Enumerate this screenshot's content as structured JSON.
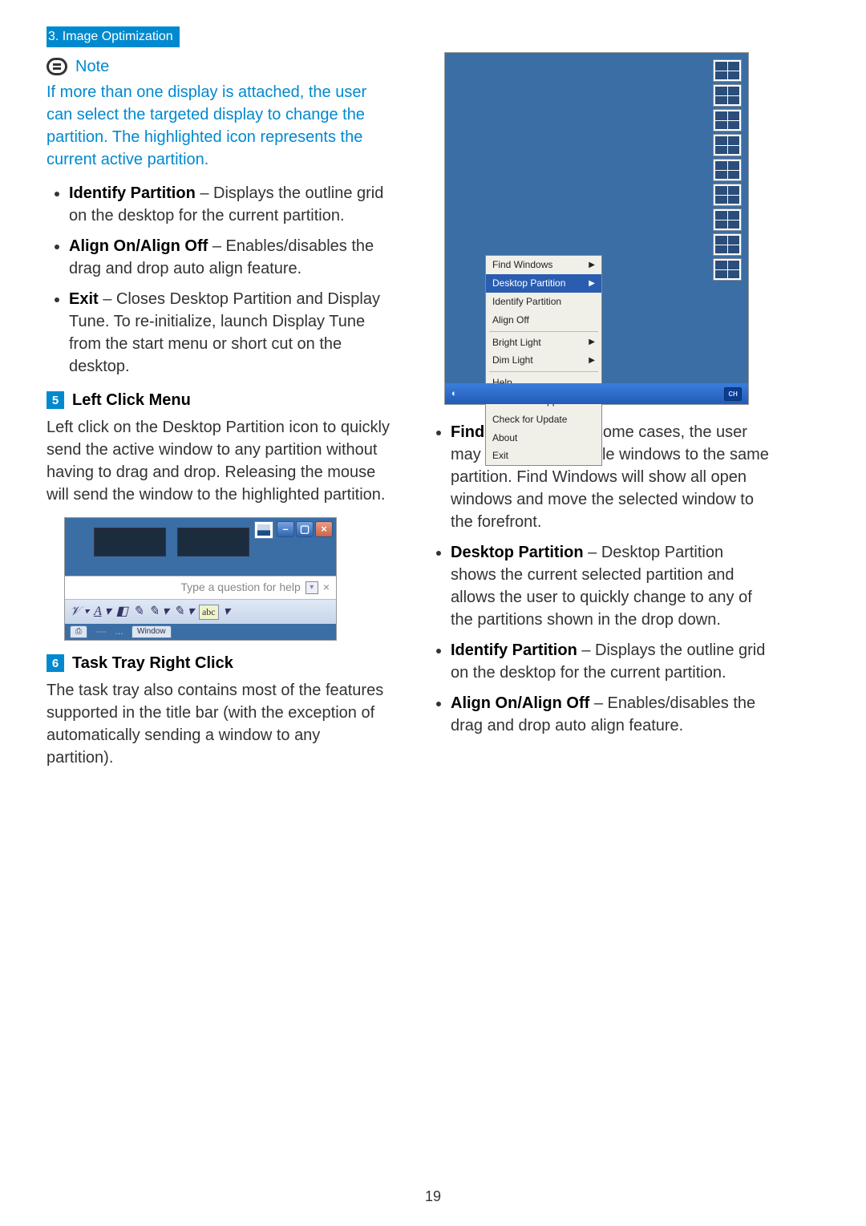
{
  "section_tag": "3. Image Optimization",
  "note_label": "Note",
  "note_text": "If more than one display is attached, the user can select the targeted display to change the partition.  The highlighted icon represents the current active partition.",
  "left_list": [
    {
      "term": "Identify Partition",
      "desc": " – Displays the outline grid on the desktop for the current partition."
    },
    {
      "term": "Align On/Align Off",
      "desc": " – Enables/disables the drag and drop auto align feature."
    },
    {
      "term": "Exit",
      "desc": " – Closes Desktop Partition and Display Tune.   To re-initialize, launch Display Tune from the start menu or short cut on the desktop."
    }
  ],
  "h5_num": "5",
  "h5_title": "Left Click Menu",
  "h5_para": "Left click on the Desktop Partition icon to quickly send the active window to any partition without having to drag and drop. Releasing the mouse will send the window to the highlighted partition.",
  "shot1": {
    "help_placeholder": "Type a question for help",
    "close": "×",
    "abc": "abc",
    "window_tab": "Window"
  },
  "h6_num": "6",
  "h6_title": "Task Tray Right Click",
  "h6_para": "The task tray also contains most of the features supported in the title bar (with the exception of automatically sending a window to any partition).",
  "ctx_menu": {
    "items_top": [
      "Find Windows"
    ],
    "highlight": "Desktop Partition",
    "items_a": [
      "Identify Partition",
      "Align Off"
    ],
    "items_b": [
      "Bright Light",
      "Dim Light"
    ],
    "items_c": [
      "Help",
      "Technical Support",
      "Check for Update",
      "About",
      "Exit"
    ]
  },
  "taskbar_lang": "сн",
  "right_list": [
    {
      "term": "Find Windows",
      "desc": " – In some cases, the user may have sent multiple windows to the same partition.   Find Windows will show all open windows and move the selected window to the forefront."
    },
    {
      "term": "Desktop Partition",
      "desc": " – Desktop Partition shows the current selected partition and allows the user to quickly change to any of the partitions shown in the drop down."
    },
    {
      "term": "Identify Partition",
      "desc": " – Displays the outline grid on the desktop for the current partition."
    },
    {
      "term": "Align On/Align Off",
      "desc": " – Enables/disables the drag and drop auto align feature."
    }
  ],
  "page_number": "19"
}
